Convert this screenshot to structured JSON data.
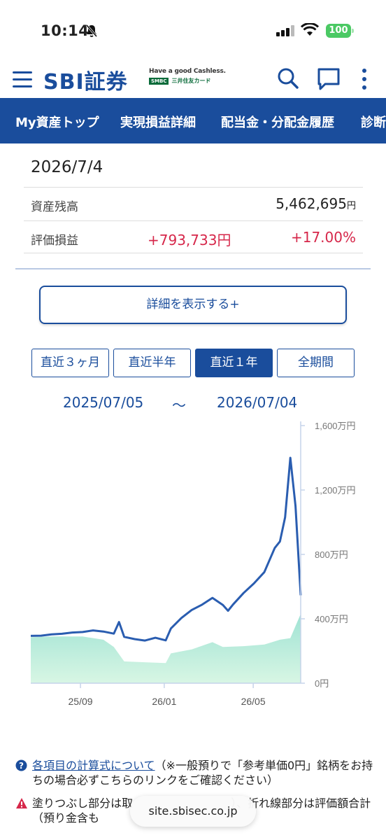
{
  "status": {
    "time": "10:14",
    "battery": "100"
  },
  "app": {
    "logo": "SBI証券",
    "partner_tagline": "Have a good Cashless.",
    "partner_bank": "SMBC",
    "partner_card": "三井住友カード"
  },
  "nav_tabs": [
    "My資産トップ",
    "実現損益詳細",
    "配当金・分配金履歴",
    "診断"
  ],
  "summary": {
    "date": "2026/7/4",
    "balance_label": "資産残高",
    "balance_value": "5,462,695",
    "balance_unit": "円",
    "pl_label": "評価損益",
    "pl_value": "+793,733円",
    "pl_percent": "+17.00%"
  },
  "detail_button": "詳細を表示する+",
  "periods": [
    "直近３ヶ月",
    "直近半年",
    "直近１年",
    "全期間"
  ],
  "active_period": "直近１年",
  "range": {
    "from": "2025/07/05",
    "sep": "〜",
    "to": "2026/07/04"
  },
  "chart_data": {
    "type": "area",
    "title": "",
    "xlabel": "",
    "ylabel": "",
    "y_ticks": [
      "1,600万円",
      "1,200万円",
      "800万円",
      "400万円",
      "0円"
    ],
    "x_ticks": [
      "25/09",
      "26/01",
      "26/05"
    ],
    "ylim": [
      0,
      16000000
    ],
    "series": [
      {
        "kind": "line",
        "color": "#2a5db0",
        "points": [
          [
            "2025-07-05",
            2940000
          ],
          [
            "2025-07-19",
            2950000
          ],
          [
            "2025-08-02",
            3030000
          ],
          [
            "2025-08-16",
            3070000
          ],
          [
            "2025-08-30",
            3150000
          ],
          [
            "2025-09-13",
            3180000
          ],
          [
            "2025-09-27",
            3280000
          ],
          [
            "2025-10-11",
            3210000
          ],
          [
            "2025-10-25",
            3080000
          ],
          [
            "2025-11-01",
            3800000
          ],
          [
            "2025-11-08",
            2880000
          ],
          [
            "2025-11-22",
            2740000
          ],
          [
            "2025-12-06",
            2650000
          ],
          [
            "2025-12-20",
            2820000
          ],
          [
            "2026-01-03",
            2660000
          ],
          [
            "2026-01-10",
            3400000
          ],
          [
            "2026-01-24",
            4050000
          ],
          [
            "2026-02-07",
            4550000
          ],
          [
            "2026-02-21",
            4880000
          ],
          [
            "2026-03-07",
            5300000
          ],
          [
            "2026-03-21",
            4860000
          ],
          [
            "2026-03-28",
            4500000
          ],
          [
            "2026-04-04",
            4900000
          ],
          [
            "2026-04-18",
            5600000
          ],
          [
            "2026-05-02",
            6200000
          ],
          [
            "2026-05-16",
            6900000
          ],
          [
            "2026-05-30",
            8400000
          ],
          [
            "2026-06-06",
            8800000
          ],
          [
            "2026-06-13",
            10300000
          ],
          [
            "2026-06-20",
            14000000
          ],
          [
            "2026-06-27",
            11000000
          ],
          [
            "2026-07-04",
            5460000
          ]
        ]
      },
      {
        "kind": "area",
        "color": "#b5ecd6",
        "points": [
          [
            "2025-07-05",
            2850000
          ],
          [
            "2025-08-02",
            2900000
          ],
          [
            "2025-09-13",
            2900000
          ],
          [
            "2025-10-11",
            2700000
          ],
          [
            "2025-10-25",
            2250000
          ],
          [
            "2025-11-08",
            1350000
          ],
          [
            "2025-12-06",
            1300000
          ],
          [
            "2026-01-03",
            1250000
          ],
          [
            "2026-01-10",
            1850000
          ],
          [
            "2026-02-07",
            2100000
          ],
          [
            "2026-03-07",
            2550000
          ],
          [
            "2026-03-21",
            2250000
          ],
          [
            "2026-04-18",
            2300000
          ],
          [
            "2026-05-16",
            2400000
          ],
          [
            "2026-06-06",
            2700000
          ],
          [
            "2026-06-20",
            2800000
          ],
          [
            "2026-07-04",
            4300000
          ]
        ]
      }
    ]
  },
  "notes": [
    {
      "link": "各項目の計算式について",
      "text": "（※一般預りで「参考単価0円」銘柄をお持ちの場合必ずこちらのリンクをご確認ください）"
    },
    {
      "text": "塗りつぶし部分は取",
      "text2": "）、折れ線部分は評価額合計（預り金含も"
    }
  ],
  "browser_url": "site.sbisec.co.jp"
}
